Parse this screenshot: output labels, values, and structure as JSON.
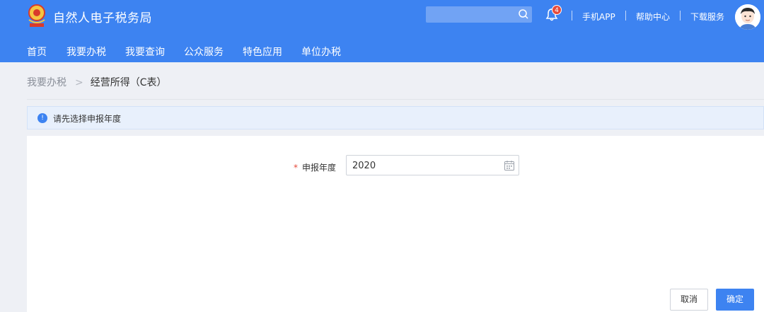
{
  "header": {
    "site_title": "自然人电子税务局",
    "notification_count": "4",
    "links": [
      "手机APP",
      "帮助中心",
      "下载服务"
    ]
  },
  "nav": {
    "items": [
      "首页",
      "我要办税",
      "我要查询",
      "公众服务",
      "特色应用",
      "单位办税"
    ]
  },
  "breadcrumb": {
    "parent": "我要办税",
    "separator": ">",
    "current": "经营所得（C表）"
  },
  "notice": {
    "text": "请先选择申报年度"
  },
  "form": {
    "required_mark": "*",
    "year_label": "申报年度",
    "year_value": "2020"
  },
  "buttons": {
    "cancel": "取消",
    "confirm": "确定"
  },
  "colors": {
    "primary": "#3d83f1",
    "badge": "#e64a3b"
  }
}
